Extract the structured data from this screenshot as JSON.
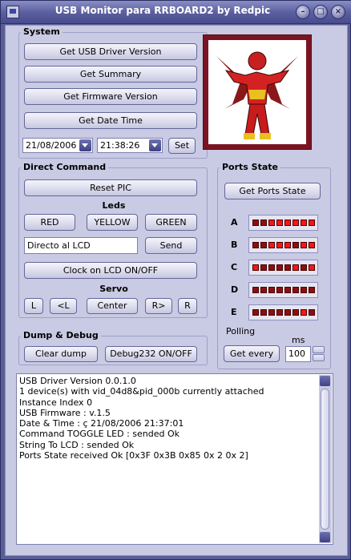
{
  "window": {
    "title": "USB Monitor para RRBOARD2 by Redpic"
  },
  "system": {
    "title": "System",
    "buttons": [
      "Get USB Driver Version",
      "Get Summary",
      "Get Firmware Version",
      "Get Date Time"
    ],
    "date": "21/08/2006",
    "time": "21:38:26",
    "set_label": "Set"
  },
  "direct": {
    "title": "Direct Command",
    "reset_label": "Reset PIC",
    "leds_label": "Leds",
    "led_buttons": [
      "RED",
      "YELLOW",
      "GREEN"
    ],
    "lcd_value": "Directo al LCD",
    "send_label": "Send",
    "clock_label": "Clock on LCD ON/OFF",
    "servo_label": "Servo",
    "servo_buttons": [
      "L",
      "<L",
      "Center",
      "R>",
      "R"
    ]
  },
  "dump": {
    "title": "Dump & Debug",
    "clear_label": "Clear dump",
    "debug_label": "Debug232 ON/OFF"
  },
  "ports": {
    "title": "Ports State",
    "get_label": "Get Ports State",
    "rows": [
      {
        "name": "A",
        "leds": [
          0,
          0,
          1,
          1,
          1,
          1,
          1,
          1
        ]
      },
      {
        "name": "B",
        "leds": [
          0,
          0,
          1,
          1,
          1,
          0,
          1,
          1
        ]
      },
      {
        "name": "C",
        "leds": [
          1,
          0,
          0,
          0,
          0,
          1,
          0,
          1
        ]
      },
      {
        "name": "D",
        "leds": [
          0,
          0,
          0,
          0,
          0,
          0,
          0,
          0
        ]
      },
      {
        "name": "E",
        "leds": [
          0,
          0,
          0,
          0,
          0,
          0,
          1,
          0
        ]
      }
    ],
    "led_on_color": "#ff1414",
    "led_off_color": "#8a1010"
  },
  "polling": {
    "label": "Polling",
    "unit": "ms",
    "button_label": "Get every",
    "value": "100"
  },
  "log": {
    "lines": [
      "USB Driver Version 0.0.1.0",
      "1 device(s) with vid_04d8&pid_000b currently attached",
      "Instance Index 0",
      "USB Firmware : v.1.5",
      "Date & Time : ç 21/08/2006 21:37:01",
      "Command TOGGLE LED : sended Ok",
      "String To LCD : sended Ok",
      "Ports State received Ok [0x3F 0x3B 0x85 0x 2 0x 2]"
    ]
  },
  "colors": {
    "window_bg": "#c9cae3",
    "titlebar": "#5c60a0",
    "picture_frame": "#7a1422"
  }
}
